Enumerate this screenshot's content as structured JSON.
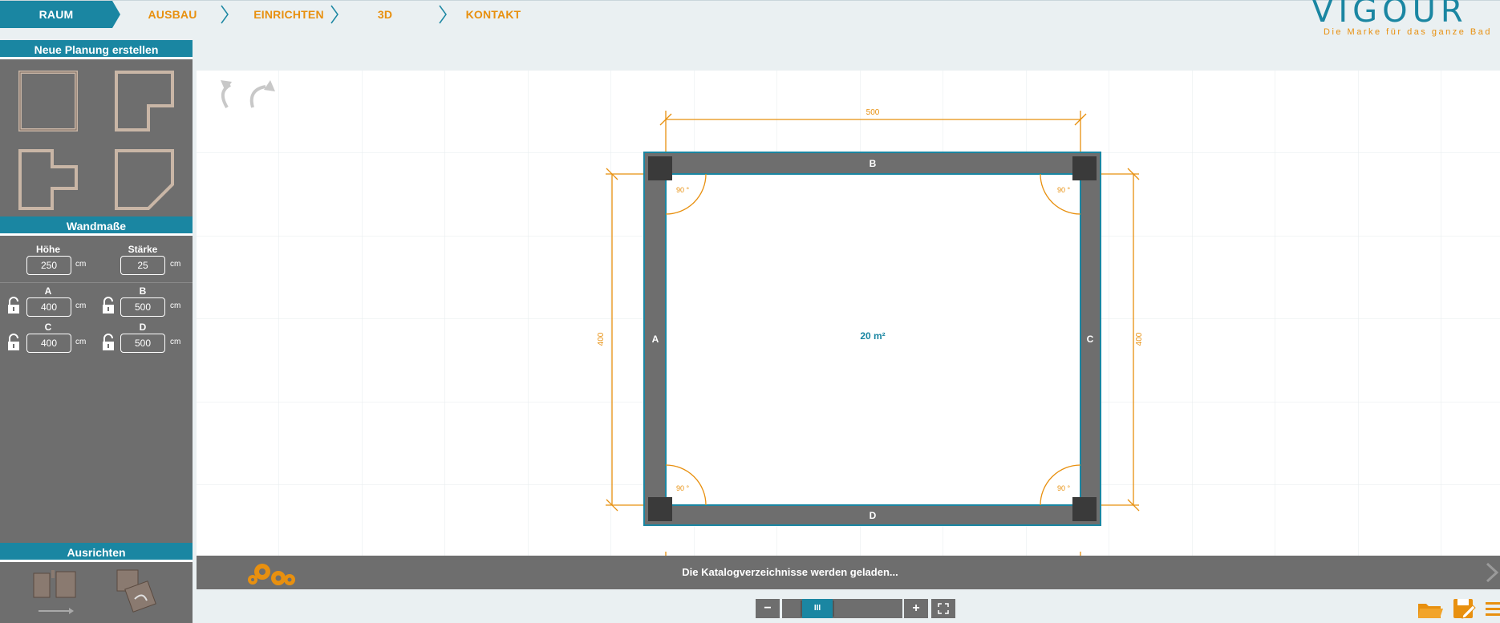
{
  "nav": {
    "steps": [
      {
        "label": "RAUM",
        "active": true
      },
      {
        "label": "AUSBAU",
        "active": false
      },
      {
        "label": "EINRICHTEN",
        "active": false
      },
      {
        "label": "3D",
        "active": false
      },
      {
        "label": "KONTAKT",
        "active": false
      }
    ]
  },
  "brand": {
    "name": "VIGOUR",
    "tagline": "Die Marke für das ganze Bad"
  },
  "sidebar": {
    "new_plan_title": "Neue Planung erstellen",
    "wall_dims_title": "Wandmaße",
    "height_label": "Höhe",
    "height_value": "250",
    "thickness_label": "Stärke",
    "thickness_value": "25",
    "unit": "cm",
    "walls": [
      {
        "label": "A",
        "value": "400"
      },
      {
        "label": "B",
        "value": "500"
      },
      {
        "label": "C",
        "value": "400"
      },
      {
        "label": "D",
        "value": "500"
      }
    ],
    "align_title": "Ausrichten"
  },
  "plan": {
    "wall_labels": {
      "top": "B",
      "left": "A",
      "right": "C",
      "bottom": "D"
    },
    "area": "20 m²",
    "dim_top": "500",
    "dim_left": "400",
    "dim_right": "400",
    "angle": "90 °"
  },
  "status": {
    "message": "Die Katalogverzeichnisse werden geladen..."
  },
  "zoom": {
    "minus": "−",
    "plus": "+",
    "level_icon": "III"
  },
  "icons": {
    "undo": "undo-icon",
    "redo": "redo-icon",
    "folder": "folder-icon",
    "save": "save-icon",
    "menu": "menu-icon",
    "gears": "gears-icon",
    "lock": "lock-icon",
    "fullscreen": "fullscreen-icon"
  },
  "colors": {
    "accent": "#1a86a2",
    "orange": "#e8900f",
    "wall": "#6e6e6e",
    "panel": "#6e6e6e"
  }
}
